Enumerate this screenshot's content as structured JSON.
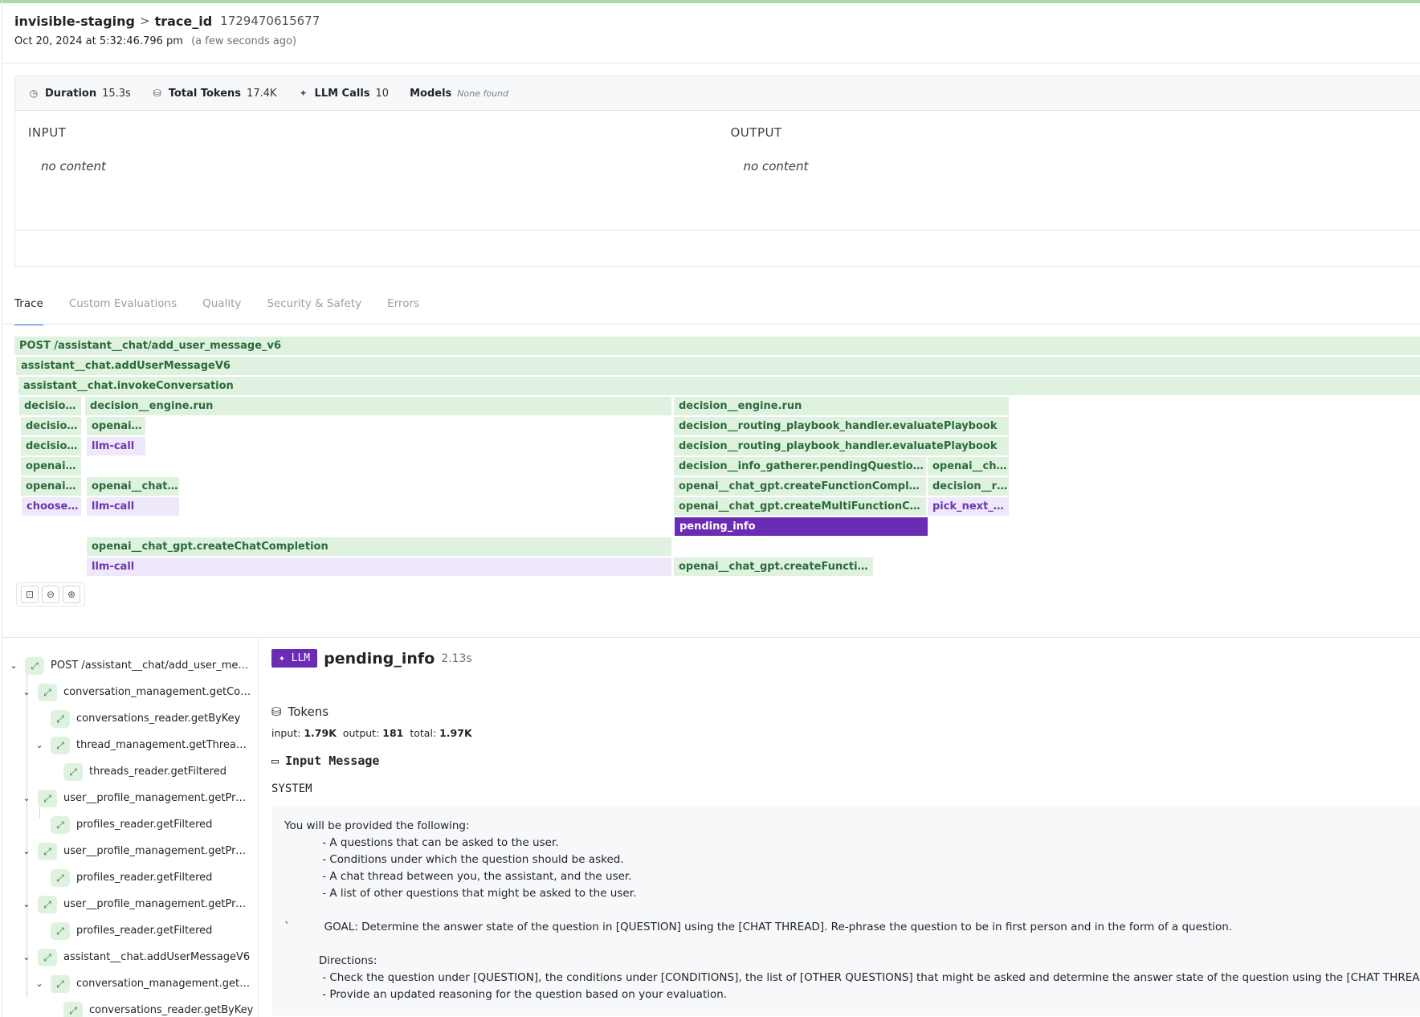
{
  "header": {
    "app": "invisible-staging",
    "key": "trace_id",
    "trace_id": "1729470615677",
    "timestamp": "Oct 20, 2024 at 5:32:46.796 pm",
    "ago": "(a few seconds ago)"
  },
  "stats": {
    "duration_label": "Duration",
    "duration": "15.3s",
    "tokens_label": "Total Tokens",
    "tokens": "17.4K",
    "calls_label": "LLM Calls",
    "calls": "10",
    "models_label": "Models",
    "models": "None found"
  },
  "io": {
    "input_label": "INPUT",
    "input": "no content",
    "output_label": "OUTPUT",
    "output": "no content"
  },
  "tabs": [
    "Trace",
    "Custom Evaluations",
    "Quality",
    "Security & Safety",
    "Errors"
  ],
  "flame": [
    "POST /assistant__chat/add_user_message_v6",
    "assistant__chat.addUserMessageV6",
    "assistant__chat.invokeConversation",
    "decision__engine.run",
    "decision__engine.run",
    "decision__engine.run",
    "decision__engine.run",
    "openai__chat_gpt.createChatCompletion",
    "decision__routing_playbook_handler.evaluatePlaybook",
    "decision__routing_playbook_handler.evaluatePlaybook",
    "decision__routing_playbook_handler.evaluatePlaybook",
    "llm-call",
    "decision__routing_playbook_handler.evaluatePlaybook",
    "openai__chat_gpt.createFunctionCompletion",
    "decision__info_gatherer.pendingQuestions",
    "openai__chat_gpt.createFunctionCompletion",
    "openai__chat_gpt.createChatCompletion",
    "openai__chat_gpt.createFunctionCompletion",
    "openai__chat_gpt.createChatCompletion",
    "choose_next_question",
    "llm-call",
    "openai__chat_gpt.createMultiFunctionCompletion",
    "pick_next_step",
    "pending_info",
    "openai__chat_gpt.createChatCompletion",
    "llm-call",
    "openai__chat_gpt.createFunctionCompletion"
  ],
  "tree": [
    "POST /assistant__chat/add_user_message_v6",
    "conversation_management.getConversation",
    "conversations_reader.getByKey",
    "thread_management.getThreadsByConversation",
    "threads_reader.getFiltered",
    "user__profile_management.getProfiles",
    "profiles_reader.getFiltered",
    "user__profile_management.getProfiles",
    "profiles_reader.getFiltered",
    "user__profile_management.getProfiles",
    "profiles_reader.getFiltered",
    "assistant__chat.addUserMessageV6",
    "conversation_management.getConversation",
    "conversations_reader.getByKey"
  ],
  "detail": {
    "badge": "LLM",
    "name": "pending_info",
    "duration": "2.13s",
    "tokens_title": "Tokens",
    "input_label": "input:",
    "input": "1.79K",
    "output_label": "output:",
    "output": "181",
    "total_label": "total:",
    "total": "1.97K",
    "input_message_title": "Input Message",
    "role": "SYSTEM",
    "message": "You will be provided the following:\n           - A questions that can be asked to the user.\n           - Conditions under which the question should be asked.\n           - A chat thread between you, the assistant, and the user.\n           - A list of other questions that might be asked to the user.\n\n`          GOAL: Determine the answer state of the question in [QUESTION] using the [CHAT THREAD]. Re-phrase the question to be in first person and in the form of a question.\n\n          Directions:\n           - Check the question under [QUESTION], the conditions under [CONDITIONS], the list of [OTHER QUESTIONS] that might be asked and determine the answer state of the question using the [CHAT THREAD].\n           - Provide an updated reasoning for the question based on your evaluation."
  },
  "colors": {
    "accent": "#2f6fde",
    "llm": "#6a2cb4",
    "span": "#dff2df",
    "span_text": "#2a6b3a"
  }
}
